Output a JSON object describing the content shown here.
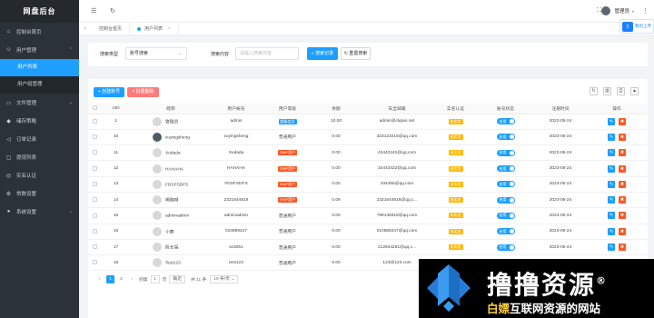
{
  "app": {
    "brand": "网盘后台"
  },
  "sidebar": {
    "items": [
      {
        "label": "控制台首页",
        "icon": "home-icon"
      },
      {
        "label": "用户管理",
        "icon": "users-icon",
        "expanded": true
      },
      {
        "label": "文件管理",
        "icon": "folder-icon"
      },
      {
        "label": "储存策略",
        "icon": "storage-icon"
      },
      {
        "label": "订单记录",
        "icon": "order-icon"
      },
      {
        "label": "提现列表",
        "icon": "withdraw-icon"
      },
      {
        "label": "实名认证",
        "icon": "verify-icon"
      },
      {
        "label": "常数设置",
        "icon": "constants-icon"
      },
      {
        "label": "系统设置",
        "icon": "settings-icon"
      }
    ],
    "submenu": [
      {
        "label": "用户列表",
        "active": true
      },
      {
        "label": "用户组管理",
        "active": false
      }
    ]
  },
  "topbar": {
    "username": "管理员",
    "upload_label": "我的上传"
  },
  "tabs": [
    {
      "label": "控制台首页"
    },
    {
      "label": "用户列表",
      "active": true
    }
  ],
  "search": {
    "type_label": "搜索类型",
    "type_value": "账号搜索",
    "content_label": "搜索内容",
    "content_placeholder": "请输入搜索内容",
    "search_button": "搜索记录",
    "reset_button": "重置搜索"
  },
  "toolbar": {
    "add_button": "+ 创建账号",
    "delete_button": "× 批量删除"
  },
  "table": {
    "columns": [
      "",
      "UID",
      "昵称",
      "用户帐号",
      "用户等级",
      "余额",
      "安全邮箱",
      "实名认证",
      "账号状态",
      "注册时间",
      "操作"
    ],
    "rows": [
      {
        "uid": "1",
        "nickname": "管理员",
        "account": "admin",
        "level": "超级会员",
        "level_color": "blue",
        "balance": "10.00",
        "email": "admin@ckpan.net",
        "verify": "未实名",
        "status": "启用",
        "date": "2023-05-24",
        "photo": false
      },
      {
        "uid": "10",
        "nickname": "xuyingsheng",
        "account": "xuyingsheng",
        "level": "普通用户",
        "level_color": "none",
        "balance": "0.00",
        "email": "323123216@qq.com",
        "verify": "未实名",
        "status": "启用",
        "date": "2023-05-24",
        "photo": true
      },
      {
        "uid": "11",
        "nickname": "Xudada",
        "account": "Xudada",
        "level": "SVIP用户",
        "level_color": "red",
        "balance": "0.00",
        "email": "43442342@qq.com",
        "verify": "未实名",
        "status": "启用",
        "date": "2023-05-24",
        "photo": false
      },
      {
        "uid": "12",
        "nickname": "HAHAHA",
        "account": "HAHAHA",
        "level": "SVIP用户",
        "level_color": "red",
        "balance": "0.00",
        "email": "34443422@qq.com",
        "verify": "未实名",
        "status": "启用",
        "date": "2023-05-24",
        "photo": false
      },
      {
        "uid": "13",
        "nickname": "FDSFSDFS",
        "account": "FDSFSDFS",
        "level": "SVIP用户",
        "level_color": "red",
        "balance": "0.00",
        "email": "434456@qq.com",
        "verify": "未实名",
        "status": "启用",
        "date": "2023-05-24",
        "photo": false
      },
      {
        "uid": "14",
        "nickname": "喝咖啡",
        "account": "2321644818",
        "level": "SVIP用户",
        "level_color": "red",
        "balance": "0.09",
        "email": "2321644818@qq.c...",
        "verify": "未实名",
        "status": "启用",
        "date": "2023-05-24",
        "photo": false
      },
      {
        "uid": "15",
        "nickname": "adminadmin",
        "account": "adminadmin",
        "level": "普通用户",
        "level_color": "none",
        "balance": "0.00",
        "email": "799145918@qq.com",
        "verify": "未实名",
        "status": "启用",
        "date": "2023-05-24",
        "photo": false
      },
      {
        "uid": "16",
        "nickname": "小鹿",
        "account": "010889247",
        "level": "普通用户",
        "level_color": "none",
        "balance": "0.00",
        "email": "010889247@qq.com",
        "verify": "未实名",
        "status": "启用",
        "date": "2023-05-24",
        "photo": false
      },
      {
        "uid": "17",
        "nickname": "段长福",
        "account": "sc6051",
        "level": "普通用户",
        "level_color": "none",
        "balance": "0.00",
        "email": "212944261@qq.c...",
        "verify": "未实名",
        "status": "启用",
        "date": "2023-05-24",
        "photo": false
      },
      {
        "uid": "18",
        "nickname": "Test123",
        "account": "test123",
        "level": "普通用户",
        "level_color": "none",
        "balance": "0.00",
        "email": "123@123.com",
        "verify": "",
        "status": "",
        "date": "",
        "photo": false
      }
    ]
  },
  "pager": {
    "pages": [
      "1",
      "2"
    ],
    "current": "1",
    "goto_label": "到第",
    "goto_value": "1",
    "page_unit": "页",
    "confirm": "确定",
    "total": "共 11 条",
    "size": "10 条/页"
  },
  "watermark": {
    "title": "撸撸资源",
    "registered": "®",
    "subtitle_pre": "白嫖",
    "subtitle_main": "互联网资源的网站"
  },
  "colors": {
    "accent": "#1e9fff",
    "danger": "#ff5722",
    "warning": "#ffb800",
    "sidebar": "#2b3238"
  }
}
